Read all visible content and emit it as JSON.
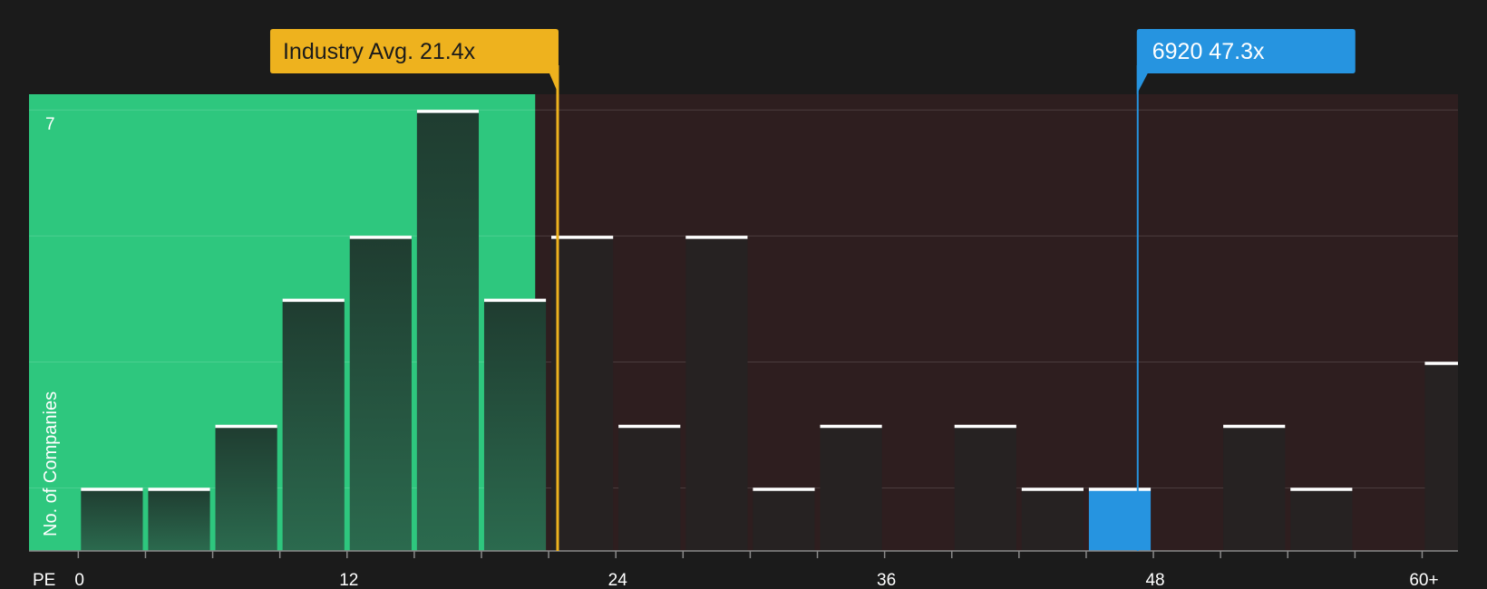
{
  "chart_data": {
    "type": "bar",
    "title": "",
    "xlabel": "PE",
    "ylabel": "No. of Companies",
    "x_tick_labels": [
      "0",
      "12",
      "24",
      "36",
      "48",
      "60+"
    ],
    "x_tick_values": [
      0,
      12,
      24,
      36,
      48,
      60
    ],
    "y_max_label": "7",
    "ylim": [
      0,
      7.25
    ],
    "xlim": [
      -2.2,
      61.6
    ],
    "bin_width": 3,
    "grid": true,
    "bins": [
      {
        "x0": 0,
        "value": 1,
        "zone": "below"
      },
      {
        "x0": 3,
        "value": 1,
        "zone": "below"
      },
      {
        "x0": 6,
        "value": 2,
        "zone": "below"
      },
      {
        "x0": 9,
        "value": 4,
        "zone": "below"
      },
      {
        "x0": 12,
        "value": 5,
        "zone": "below"
      },
      {
        "x0": 15,
        "value": 7,
        "zone": "below"
      },
      {
        "x0": 18,
        "value": 4,
        "zone": "below"
      },
      {
        "x0": 21,
        "value": 5,
        "zone": "above"
      },
      {
        "x0": 24,
        "value": 2,
        "zone": "above"
      },
      {
        "x0": 27,
        "value": 5,
        "zone": "above"
      },
      {
        "x0": 30,
        "value": 1,
        "zone": "above"
      },
      {
        "x0": 33,
        "value": 2,
        "zone": "above"
      },
      {
        "x0": 36,
        "value": 0,
        "zone": "above"
      },
      {
        "x0": 39,
        "value": 2,
        "zone": "above"
      },
      {
        "x0": 42,
        "value": 1,
        "zone": "above"
      },
      {
        "x0": 45,
        "value": 1,
        "zone": "highlight"
      },
      {
        "x0": 48,
        "value": 0,
        "zone": "above"
      },
      {
        "x0": 51,
        "value": 2,
        "zone": "above"
      },
      {
        "x0": 54,
        "value": 1,
        "zone": "above"
      },
      {
        "x0": 57,
        "value": 0,
        "zone": "above"
      },
      {
        "x0": 60,
        "value": 3,
        "zone": "above"
      }
    ],
    "green_zone_end": 20.4,
    "industry_avg": {
      "label": "Industry Avg. 21.4x",
      "value": 21.4
    },
    "company": {
      "label": "6920 47.3x",
      "value": 47.3
    },
    "colors": {
      "background": "#1b1b1b",
      "green_zone": "#2ec77e",
      "red_zone": "#2e1e1f",
      "bar_green": "#25493a",
      "bar_dark": "#262222",
      "bar_highlight": "#2694e0",
      "industry_marker": "#eeb21e",
      "company_marker": "#2694e0",
      "bar_cap": "#ffffff",
      "axis_text": "#ffffff"
    }
  }
}
